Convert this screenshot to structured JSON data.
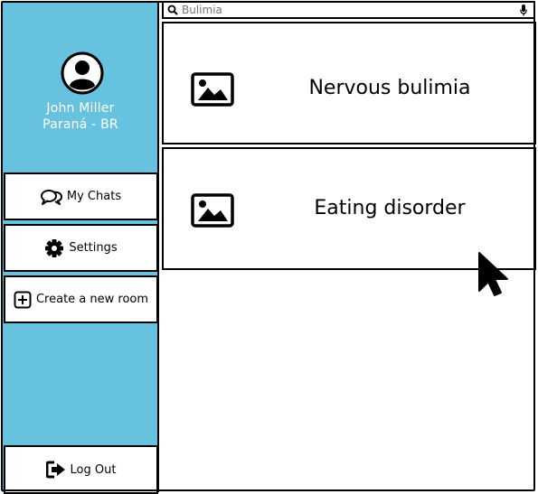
{
  "user": {
    "name": "John Miller",
    "location": "Paraná - BR",
    "avatar_icon": "user-avatar-icon"
  },
  "sidebar": {
    "background": "#67c2e0",
    "items": [
      {
        "label": "My Chats",
        "icon": "chat-bubbles-icon"
      },
      {
        "label": "Settings",
        "icon": "gear-icon"
      },
      {
        "label": "Create a new room",
        "icon": "plus-square-icon"
      }
    ],
    "logout": {
      "label": "Log Out",
      "icon": "logout-icon"
    }
  },
  "search": {
    "value": "Bulimia",
    "icon": "search-icon",
    "mic_icon": "microphone-icon"
  },
  "results": [
    {
      "title": "Nervous bulimia",
      "icon": "image-icon"
    },
    {
      "title": "Eating disorder",
      "icon": "image-icon"
    }
  ]
}
